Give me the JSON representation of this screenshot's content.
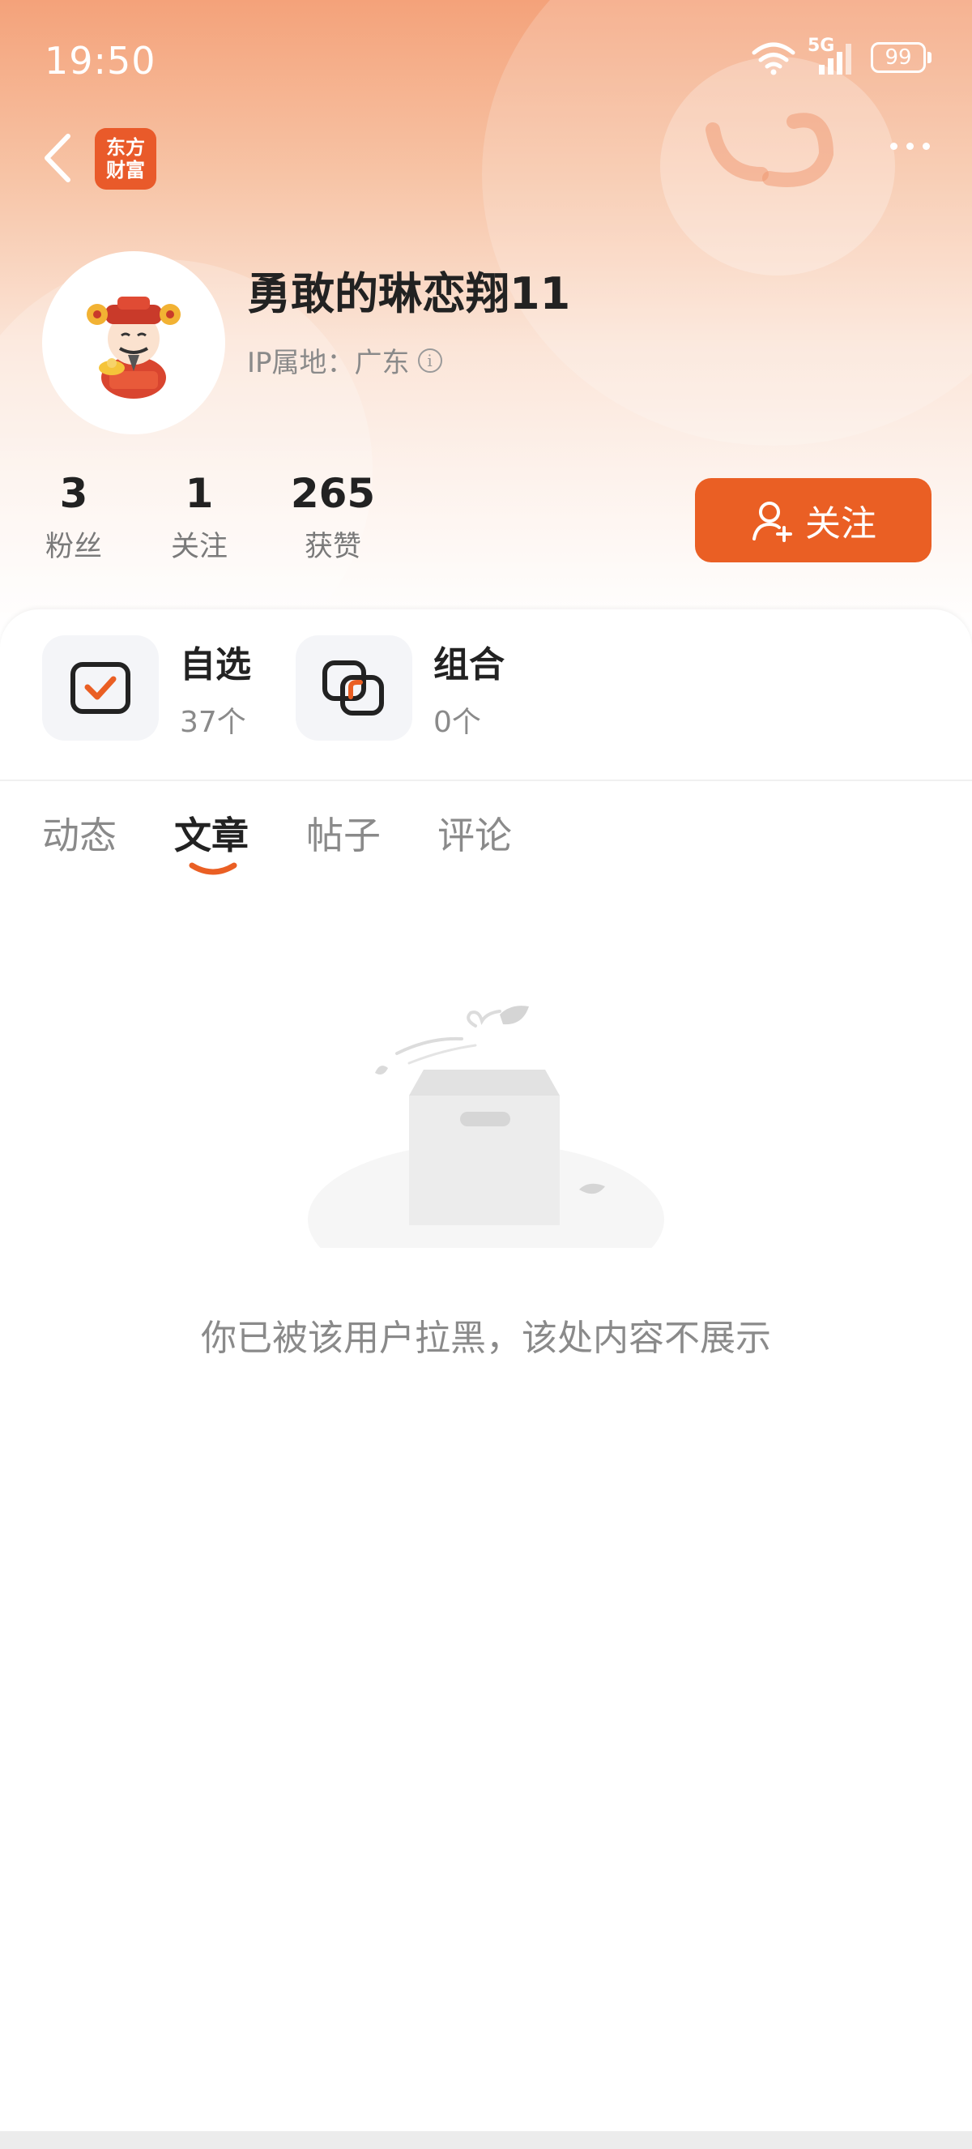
{
  "status_bar": {
    "time": "19:50",
    "network": "5G",
    "battery": "99"
  },
  "nav": {
    "back_icon": "chevron-left-icon",
    "logo_line1": "东方",
    "logo_line2": "财富",
    "more_icon": "more-horizontal-icon"
  },
  "profile": {
    "username": "勇敢的琳恋翔11",
    "ip_label": "IP属地：广东",
    "avatar_icon": "fortune-god-avatar-icon"
  },
  "stats": [
    {
      "value": "3",
      "label": "粉丝"
    },
    {
      "value": "1",
      "label": "关注"
    },
    {
      "value": "265",
      "label": "获赞"
    }
  ],
  "follow_button": {
    "label": "关注",
    "icon": "add-user-icon"
  },
  "quick_links": [
    {
      "title": "自选",
      "count": "37个",
      "icon": "checkbox-icon"
    },
    {
      "title": "组合",
      "count": "0个",
      "icon": "portfolio-icon"
    }
  ],
  "tabs": [
    {
      "label": "动态",
      "active": false
    },
    {
      "label": "文章",
      "active": true
    },
    {
      "label": "帖子",
      "active": false
    },
    {
      "label": "评论",
      "active": false
    }
  ],
  "empty_state": {
    "message": "你已被该用户拉黑，该处内容不展示",
    "icon": "empty-box-icon"
  },
  "colors": {
    "accent": "#ea5f24",
    "header_top": "#f4a27a",
    "text_primary": "#222222",
    "text_secondary": "#8a8a8a"
  }
}
